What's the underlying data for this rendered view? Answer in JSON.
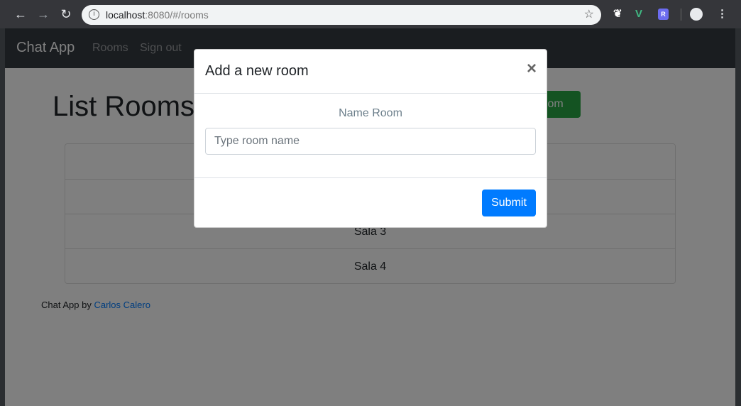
{
  "browser": {
    "url_host": "localhost",
    "url_rest": ":8080/#/rooms"
  },
  "navbar": {
    "brand": "Chat App",
    "links": [
      "Rooms",
      "Sign out"
    ]
  },
  "page": {
    "title": "List Rooms",
    "add_button": "Add room",
    "rooms": [
      "",
      "",
      "Sala 3",
      "Sala 4"
    ]
  },
  "footer": {
    "text": "Chat App by ",
    "author": "Carlos Calero"
  },
  "modal": {
    "title": "Add a new room",
    "close": "×",
    "label": "Name Room",
    "input_placeholder": "Type room name",
    "input_value": "",
    "submit": "Submit"
  },
  "colors": {
    "primary": "#007bff",
    "success": "#28a745",
    "navbar": "#343a40"
  }
}
